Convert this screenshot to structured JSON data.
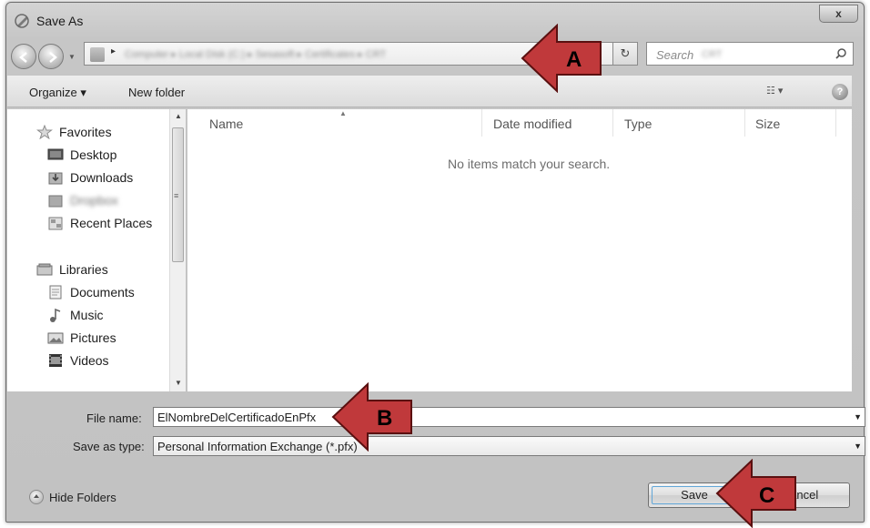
{
  "window": {
    "title": "Save As",
    "close_glyph": "x",
    "icon": "save-as-icon"
  },
  "address": {
    "path_blurred": "Computer  ▸  Local Disk (C:)  ▸  Sesasoft  ▸  Certificates  ▸  CRT",
    "separator": "▸",
    "refresh_glyph": "↻",
    "search_placeholder": "Search",
    "search_blurred": "CRT"
  },
  "toolbar": {
    "organize": "Organize ▾",
    "new_folder": "New folder",
    "views_glyph": "☷ ▾",
    "help_glyph": "?"
  },
  "nav_tree": {
    "favorites": "Favorites",
    "desktop": "Desktop",
    "downloads": "Downloads",
    "blurred_item": "Dropbox",
    "recent_places": "Recent Places",
    "libraries": "Libraries",
    "documents": "Documents",
    "music": "Music",
    "pictures": "Pictures",
    "videos": "Videos"
  },
  "file_list": {
    "columns": [
      "Name",
      "Date modified",
      "Type",
      "Size"
    ],
    "empty_message": "No items match your search."
  },
  "form": {
    "file_name_label": "File name:",
    "file_name_value": "ElNombreDelCertificadoEnPfx",
    "save_as_type_label": "Save as type:",
    "save_as_type_value": "Personal Information Exchange (*.pfx)"
  },
  "footer": {
    "hide_folders": "Hide Folders",
    "save": "Save",
    "cancel": "Cancel"
  },
  "callouts": {
    "a": "A",
    "b": "B",
    "c": "C",
    "color": "#c0393b"
  }
}
